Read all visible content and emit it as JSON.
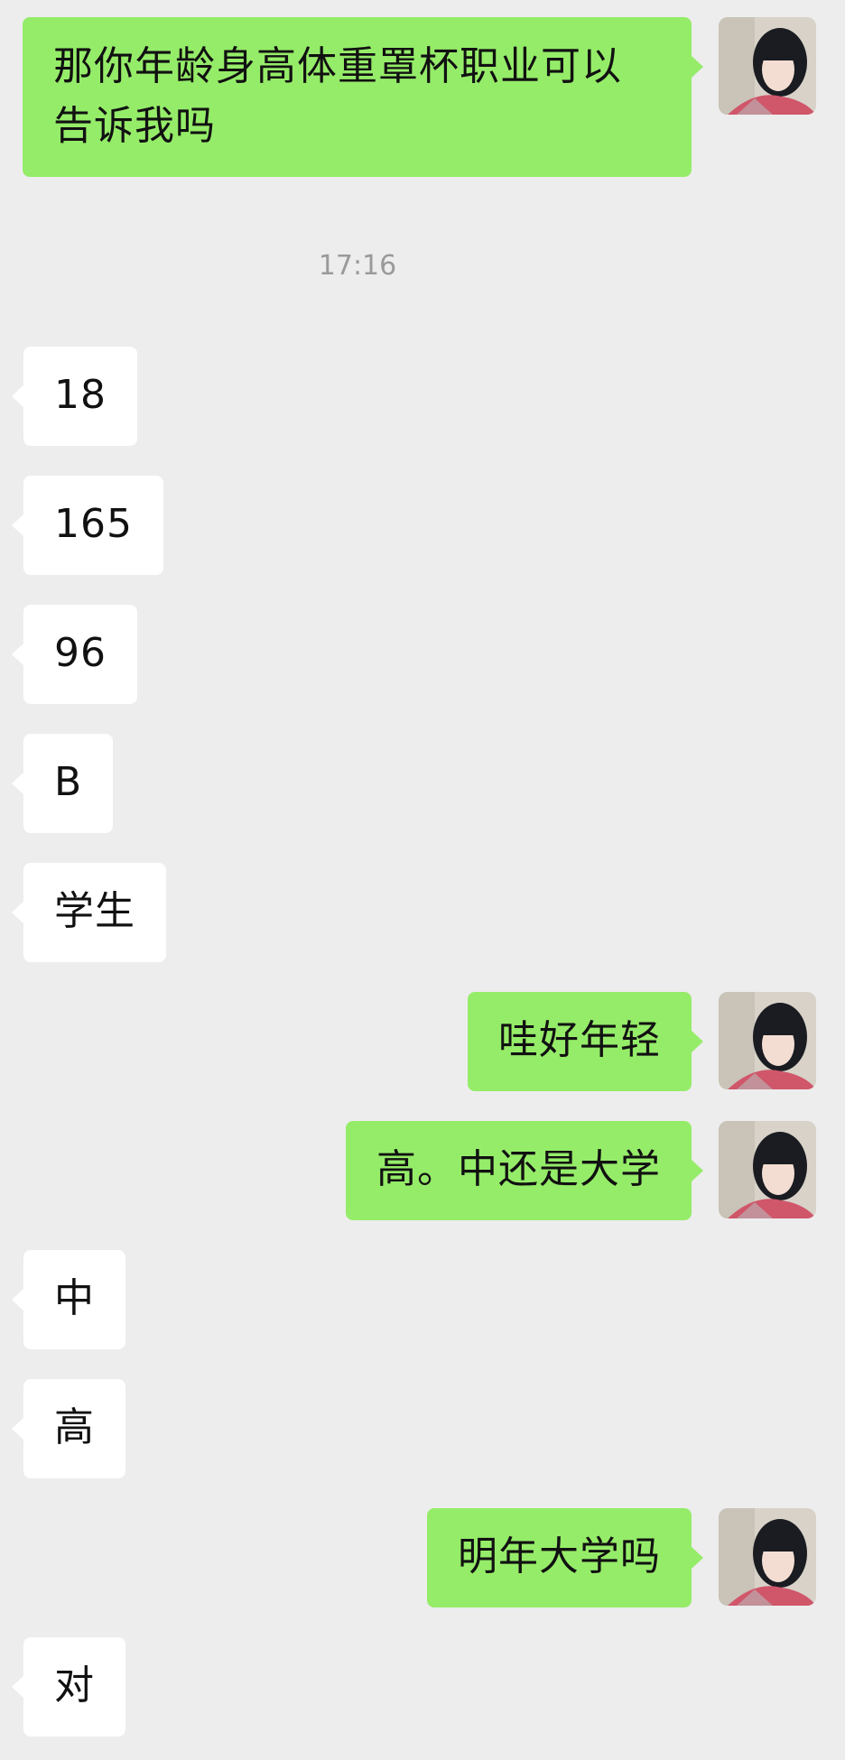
{
  "chat": {
    "messages": [
      {
        "side": "out",
        "text": "那你年龄身高体重罩杯职业可以告诉我吗"
      },
      {
        "timestamp": "17:16"
      },
      {
        "side": "in",
        "text": "18"
      },
      {
        "side": "in",
        "text": "165"
      },
      {
        "side": "in",
        "text": "96"
      },
      {
        "side": "in",
        "text": "B"
      },
      {
        "side": "in",
        "text": "学生"
      },
      {
        "side": "out",
        "text": "哇好年轻"
      },
      {
        "side": "out",
        "text": "高。中还是大学"
      },
      {
        "side": "in",
        "text": "中"
      },
      {
        "side": "in",
        "text": "高"
      },
      {
        "side": "out",
        "text": "明年大学吗"
      },
      {
        "side": "in",
        "text": "对"
      }
    ]
  },
  "colors": {
    "background": "#ededed",
    "outgoing_bubble": "#95ec69",
    "incoming_bubble": "#ffffff",
    "timestamp_text": "#9a9a9a"
  },
  "icons": {
    "self_avatar": "avatar-photo"
  }
}
